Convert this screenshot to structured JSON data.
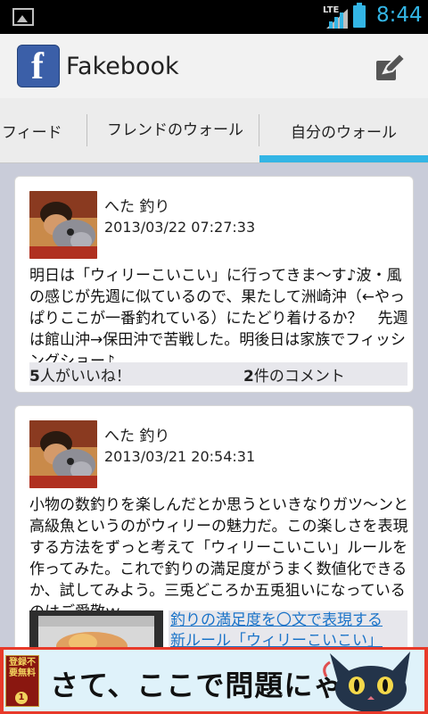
{
  "statusbar": {
    "network": "LTE",
    "time": "8:44",
    "battery_color": "#33b5e5"
  },
  "app": {
    "title": "Fakebook",
    "logo_letter": "f",
    "brand_color": "#3b5fa8"
  },
  "tabs": [
    {
      "label": "フィード"
    },
    {
      "label": "フレンドのウォール"
    },
    {
      "label": "自分のウォール",
      "selected": true
    }
  ],
  "posts": [
    {
      "author": "へた 釣り",
      "timestamp": "2013/03/22 07:27:33",
      "body": "明日は「ウィリーこいこい」に行ってきま～す♪波・風の感じが先週に似ているので、果たして洲崎沖（←やっぱりここが一番釣れている）にたどり着けるか？　先週は館山沖→保田沖で苦戦した。明後日は家族でフィッシングショー♪",
      "likes_count": "5",
      "likes_suffix": "人がいいね！",
      "comments_count": "2",
      "comments_suffix": "件のコメント"
    },
    {
      "author": "へた 釣り",
      "timestamp": "2013/03/21 20:54:31",
      "body": "小物の数釣りを楽しんだとか思うといきなりガツ～ンと高級魚というのがウィリーの魅力だ。この楽しさを表現する方法をずっと考えて「ウィリーこいこい」ルールを作ってみた。これで釣りの満足度がうまく数値化できるか、試してみよう。三兎どころか五兎狙いになっているのはご愛敬ｗ",
      "link_line1": "釣りの満足度を〇文で表現する",
      "link_line2": "新ルール「ウィリーこいこい」"
    }
  ],
  "ad": {
    "badge_text": "登録不要無料",
    "badge_number": "1",
    "text": "さて、ここで問題にゃ！"
  }
}
